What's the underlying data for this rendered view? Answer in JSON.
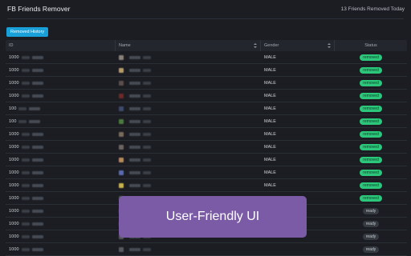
{
  "header": {
    "title": "FB Friends Remover",
    "removed_today": "13 Friends Removed Today"
  },
  "toolbar": {
    "history_label": "Removed History"
  },
  "table": {
    "columns": {
      "id": "ID",
      "name": "Name",
      "gender": "Gender",
      "status": "Status"
    },
    "rows": [
      {
        "id": "1000",
        "gender": "MALE",
        "status": "removed",
        "avatar": "#8a8278"
      },
      {
        "id": "1000",
        "gender": "MALE",
        "status": "removed",
        "avatar": "#b59a6a"
      },
      {
        "id": "1000",
        "gender": "MALE",
        "status": "removed",
        "avatar": "#5a4e4a"
      },
      {
        "id": "1000",
        "gender": "MALE",
        "status": "removed",
        "avatar": "#6b2a2a"
      },
      {
        "id": "100",
        "gender": "MALE",
        "status": "removed",
        "avatar": "#3d4a6b"
      },
      {
        "id": "100",
        "gender": "MALE",
        "status": "removed",
        "avatar": "#4a7a3e"
      },
      {
        "id": "1000",
        "gender": "MALE",
        "status": "removed",
        "avatar": "#7a6a5a"
      },
      {
        "id": "1000",
        "gender": "MALE",
        "status": "removed",
        "avatar": "#6e6560"
      },
      {
        "id": "1000",
        "gender": "MALE",
        "status": "removed",
        "avatar": "#b58a5a"
      },
      {
        "id": "1000",
        "gender": "MALE",
        "status": "removed",
        "avatar": "#5a6ab0"
      },
      {
        "id": "1000",
        "gender": "MALE",
        "status": "removed",
        "avatar": "#c7b24a"
      },
      {
        "id": "1000",
        "gender": "",
        "status": "removed",
        "avatar": "#4a5a4a"
      },
      {
        "id": "1000",
        "gender": "",
        "status": "ready",
        "avatar": "#55595f"
      },
      {
        "id": "1000",
        "gender": "",
        "status": "ready",
        "avatar": "#55595f"
      },
      {
        "id": "1000",
        "gender": "",
        "status": "ready",
        "avatar": "#55595f"
      },
      {
        "id": "1000",
        "gender": "",
        "status": "ready",
        "avatar": "#55595f"
      }
    ]
  },
  "overlay": {
    "text": "User-Friendly UI"
  },
  "colors": {
    "background": "#1b1d23",
    "accent": "#1aa0d8",
    "removed_badge": "#2cc77a",
    "ready_badge": "#353940",
    "overlay": "#7b5ba6"
  }
}
